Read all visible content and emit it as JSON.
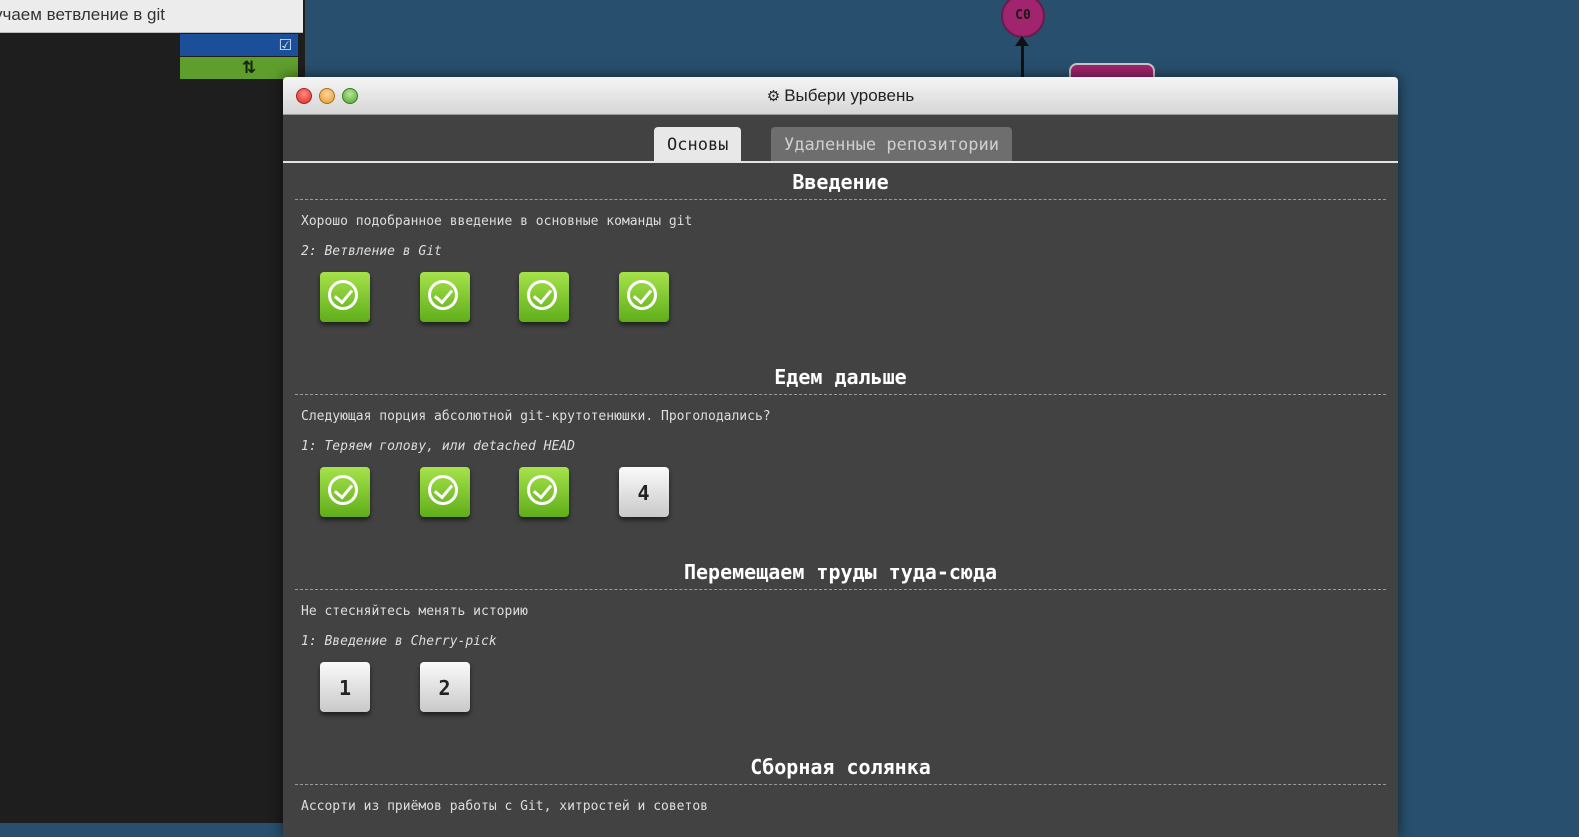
{
  "background": {
    "left_title": "учаем ветвление в git",
    "commit_label": "C0"
  },
  "modal": {
    "title": "Выбери уровень",
    "tabs": [
      {
        "label": "Основы",
        "active": true
      },
      {
        "label": "Удаленные репозитории",
        "active": false
      }
    ],
    "sections": [
      {
        "title": "Введение",
        "description": "Хорошо подобранное введение в основные команды git",
        "subtitle": "2: Ветвление в Git",
        "levels": [
          {
            "label": "",
            "done": true
          },
          {
            "label": "",
            "done": true
          },
          {
            "label": "",
            "done": true
          },
          {
            "label": "",
            "done": true
          }
        ]
      },
      {
        "title": "Едем дальше",
        "description": "Следующая порция абсолютной git-крутотенюшки. Проголодались?",
        "subtitle": "1: Теряем голову, или detached HEAD",
        "levels": [
          {
            "label": "",
            "done": true
          },
          {
            "label": "",
            "done": true
          },
          {
            "label": "",
            "done": true
          },
          {
            "label": "4",
            "done": false
          }
        ]
      },
      {
        "title": "Перемещаем труды туда-сюда",
        "description": "Не стесняйтесь менять историю",
        "subtitle": "1: Введение в Cherry-pick",
        "levels": [
          {
            "label": "1",
            "done": false
          },
          {
            "label": "2",
            "done": false
          }
        ]
      },
      {
        "title": "Сборная солянка",
        "description": "Ассорти из приёмов работы с Git, хитростей и советов"
      }
    ]
  },
  "colors": {
    "done_green": "#7cc832",
    "modal_bg": "#424242",
    "page_bg": "#28506e"
  }
}
